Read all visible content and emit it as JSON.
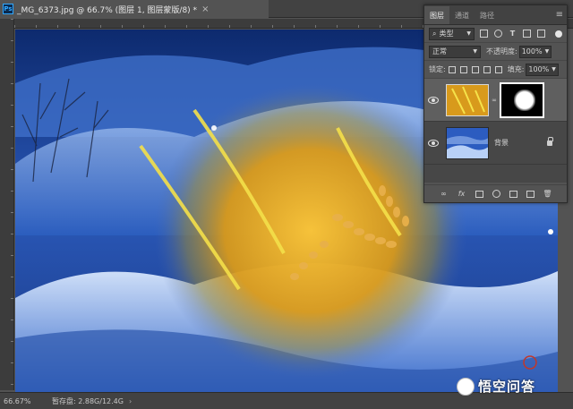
{
  "document": {
    "app_icon": "Ps",
    "tab_title": "_MG_6373.jpg @ 66.7% (图层 1, 图层蒙版/8) *",
    "close_glyph": "×"
  },
  "status": {
    "zoom": "66.67%",
    "scratch": "暂存盘: 2.88G/12.4G",
    "arrow": "›"
  },
  "watermark": {
    "text": "悟空问答"
  },
  "layers_panel": {
    "tabs": [
      {
        "label": "图层",
        "active": true
      },
      {
        "label": "通道",
        "active": false
      },
      {
        "label": "路径",
        "active": false
      }
    ],
    "menu_glyph": "≡",
    "filter": {
      "value": "类型"
    },
    "blend_mode": "正常",
    "opacity_label": "不透明度:",
    "opacity": "100%",
    "lock_label": "锁定:",
    "fill_label": "填充:",
    "fill": "100%",
    "layers": [
      {
        "name": "",
        "selected": true,
        "has_mask": true
      },
      {
        "name": "背景",
        "selected": false,
        "locked": true
      }
    ]
  },
  "colors": {
    "panel_bg": "#535353",
    "canvas_snow": "#1d3e8a",
    "highlight": "#31a8ff"
  }
}
